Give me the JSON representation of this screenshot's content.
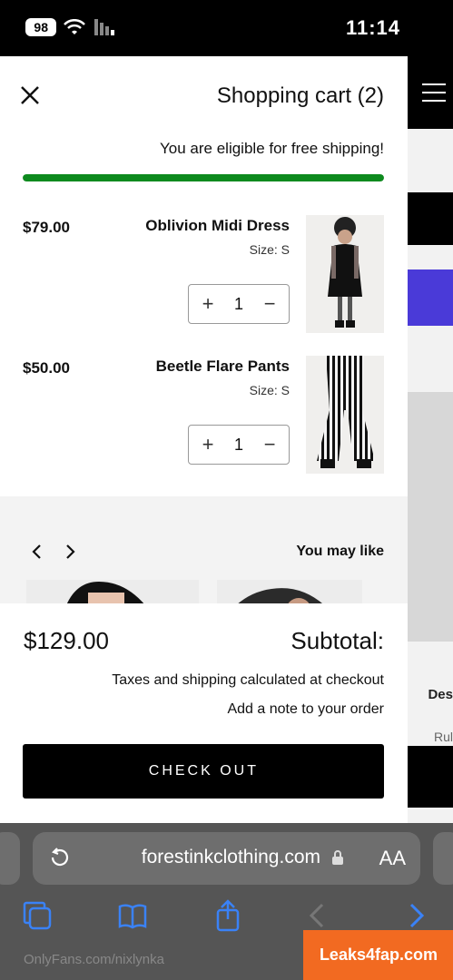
{
  "status_bar": {
    "time": "11:14",
    "battery": "98"
  },
  "cart": {
    "title": "Shopping cart (2)",
    "shipping_message": "You are eligible for free shipping!",
    "shipping_progress": 1.0,
    "items": [
      {
        "name": "Oblivion Midi Dress",
        "size": "Size: S",
        "price": "$79.00",
        "quantity": "1"
      },
      {
        "name": "Beetle Flare Pants",
        "size": "Size: S",
        "price": "$50.00",
        "quantity": "1"
      }
    ],
    "recommendations_title": "You may like",
    "subtotal_label": "Subtotal:",
    "subtotal_value": "$129.00",
    "taxes_note": "Taxes and shipping calculated at checkout",
    "note_link": "Add a note to your order",
    "checkout_label": "CHECK OUT"
  },
  "background_site": {
    "desc_label": "Des",
    "rul_label": "Rul"
  },
  "safari": {
    "aa_label": "AA",
    "url": "forestinkclothing.com"
  },
  "watermarks": {
    "left": "Leaks4fap.com",
    "right": "OnlyFans.com/nixlynka"
  },
  "colors": {
    "progress": "#0d8a1e",
    "accent_button": "#000000",
    "site_accent": "#4a3ad8"
  }
}
